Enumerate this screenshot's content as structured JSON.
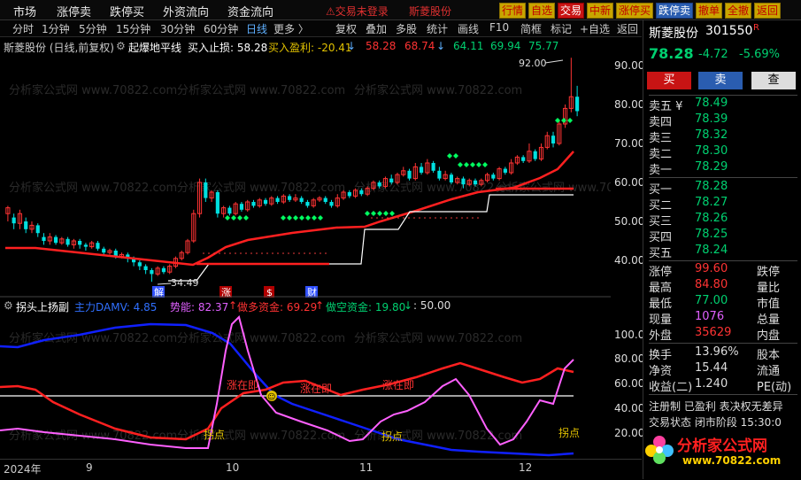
{
  "topbar": {
    "menu": [
      "市场",
      "涨停卖",
      "跌停买",
      "外资流向",
      "资金流向"
    ],
    "warning": "交易未登录",
    "stock_name_top": "斯菱股份",
    "buttons": [
      "行情",
      "自选",
      "交易",
      "中新",
      "涨停买",
      "跌停卖",
      "撤单",
      "全撤",
      "返回"
    ]
  },
  "periods": {
    "items": [
      "分时",
      "1分钟",
      "5分钟",
      "15分钟",
      "30分钟",
      "60分钟",
      "日线",
      "更多 〉"
    ],
    "active": "日线"
  },
  "tools": [
    "复权",
    "叠加",
    "多股",
    "统计",
    "画线",
    "F10",
    "简框",
    "标记",
    "+自选",
    "返回"
  ],
  "indicator_main": {
    "title": "斯菱股份 (日线,前复权)",
    "name": "起爆地平线",
    "stoploss_label": "买入止损: 58.28",
    "profit_label": "买入盈利: -20.41",
    "v1": "58.28",
    "v2": "68.74",
    "v3": "64.11",
    "v4": "69.94",
    "v5": "75.77"
  },
  "indicator_sub": {
    "name": "拐头上扬副",
    "main_funds": "主力DAMV: 4.85",
    "momentum": "势能: 82.37",
    "long_funds": "做多资金: 69.29",
    "short_funds": "做空资金: 19.80",
    "level": ": 50.00"
  },
  "chart_labels": {
    "high_marker": "92.00",
    "low_marker": "34.49",
    "jie": "解",
    "zhang": "涨",
    "dollar": "$",
    "cai": "财",
    "zhangzaiji": "涨在即",
    "guaidian": "拐点",
    "watermark": "分析家公式网 www.70822.com"
  },
  "price_axis": [
    "90.00",
    "80.00",
    "70.00",
    "60.00",
    "50.00",
    "40.00"
  ],
  "sub_axis": [
    "100.0",
    "80.00",
    "60.00",
    "40.00",
    "20.00"
  ],
  "x_axis": [
    "2024年",
    "9",
    "10",
    "11",
    "12"
  ],
  "quote": {
    "name": "斯菱股份",
    "code": "301550",
    "tag": "R",
    "price": "78.28",
    "change": "-4.72",
    "pct": "-5.69%",
    "buy_btn": "买",
    "sell_btn": "卖",
    "query_btn": "查",
    "asks": [
      {
        "label": "卖五 ¥",
        "price": "78.49"
      },
      {
        "label": "卖四",
        "price": "78.39"
      },
      {
        "label": "卖三",
        "price": "78.32"
      },
      {
        "label": "卖二",
        "price": "78.30"
      },
      {
        "label": "卖一",
        "price": "78.29"
      }
    ],
    "bids": [
      {
        "label": "买一",
        "price": "78.28"
      },
      {
        "label": "买二",
        "price": "78.27"
      },
      {
        "label": "买三",
        "price": "78.26"
      },
      {
        "label": "买四",
        "price": "78.25"
      },
      {
        "label": "买五",
        "price": "78.24"
      }
    ],
    "stats": [
      {
        "l": "涨停",
        "v": "99.60",
        "r": "跌停"
      },
      {
        "l": "最高",
        "v": "84.80",
        "r": "量比"
      },
      {
        "l": "最低",
        "v": "77.00",
        "r": "市值"
      },
      {
        "l": "现量",
        "v": "1076",
        "r": "总量"
      },
      {
        "l": "外盘",
        "v": "35629",
        "r": "内盘"
      }
    ],
    "stats2": [
      {
        "l": "换手",
        "v": "13.96%",
        "r": "股本"
      },
      {
        "l": "净资",
        "v": "15.44",
        "r": "流通"
      },
      {
        "l": "收益(二)",
        "v": "1.240",
        "r": "PE(动)"
      }
    ],
    "footer1": "注册制 已盈利 表决权无差异",
    "footer2": "交易状态 闭市阶段 15:30:0",
    "logo": "分析家公式网",
    "logo_url": "www.70822.com"
  },
  "colors": {
    "up": "#ff3333",
    "down": "#00e0e0",
    "green": "#00d070",
    "magenta": "#ff60ff",
    "blue": "#2030ff",
    "yellow": "#e0c000"
  }
}
